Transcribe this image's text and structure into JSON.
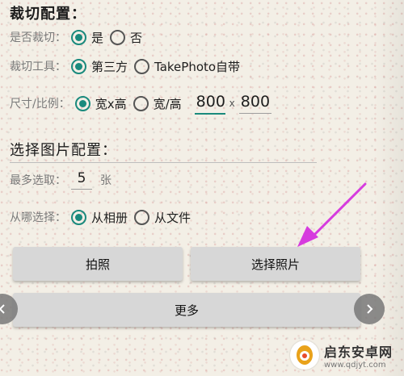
{
  "crop": {
    "heading": "裁切配置：",
    "should_crop": {
      "label": "是否裁切：",
      "options": [
        "是",
        "否"
      ],
      "selected": "是"
    },
    "tool": {
      "label": "裁切工具：",
      "options": [
        "第三方",
        "TakePhoto自带"
      ],
      "selected": "第三方"
    },
    "size": {
      "label": "尺寸/比例：",
      "options": [
        "宽x高",
        "宽/高"
      ],
      "selected": "宽x高",
      "width": "800",
      "separator": "x",
      "height": "800"
    }
  },
  "pick": {
    "heading": "选择图片配置：",
    "max": {
      "label": "最多选取：",
      "value": "5",
      "unit": "张"
    },
    "source": {
      "label": "从哪选择：",
      "options": [
        "从相册",
        "从文件"
      ],
      "selected": "从相册"
    }
  },
  "buttons": {
    "take_photo": "拍照",
    "select_photo": "选择照片",
    "more": "更多"
  },
  "watermark": {
    "title": "启东安卓网",
    "url": "www.qdjyt.com"
  },
  "colors": {
    "accent": "#1a8a7d",
    "annotation_arrow": "#d63bde"
  }
}
